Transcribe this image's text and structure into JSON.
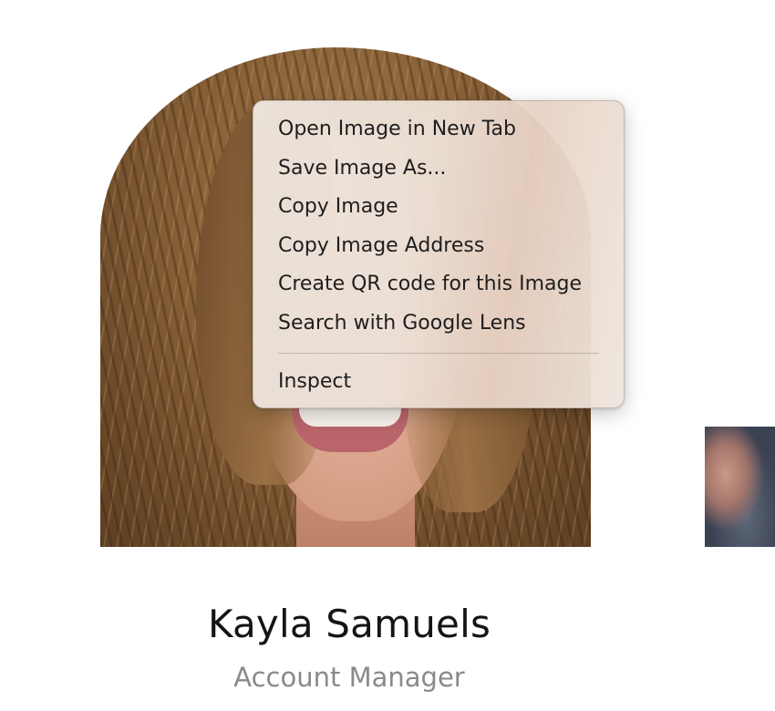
{
  "profile": {
    "name": "Kayla Samuels",
    "title": "Account Manager"
  },
  "context_menu": {
    "items": [
      {
        "label": "Open Image in New Tab"
      },
      {
        "label": "Save Image As..."
      },
      {
        "label": "Copy Image"
      },
      {
        "label": "Copy Image Address"
      },
      {
        "label": "Create QR code for this Image"
      },
      {
        "label": "Search with Google Lens"
      }
    ],
    "secondary_items": [
      {
        "label": "Inspect"
      }
    ]
  }
}
